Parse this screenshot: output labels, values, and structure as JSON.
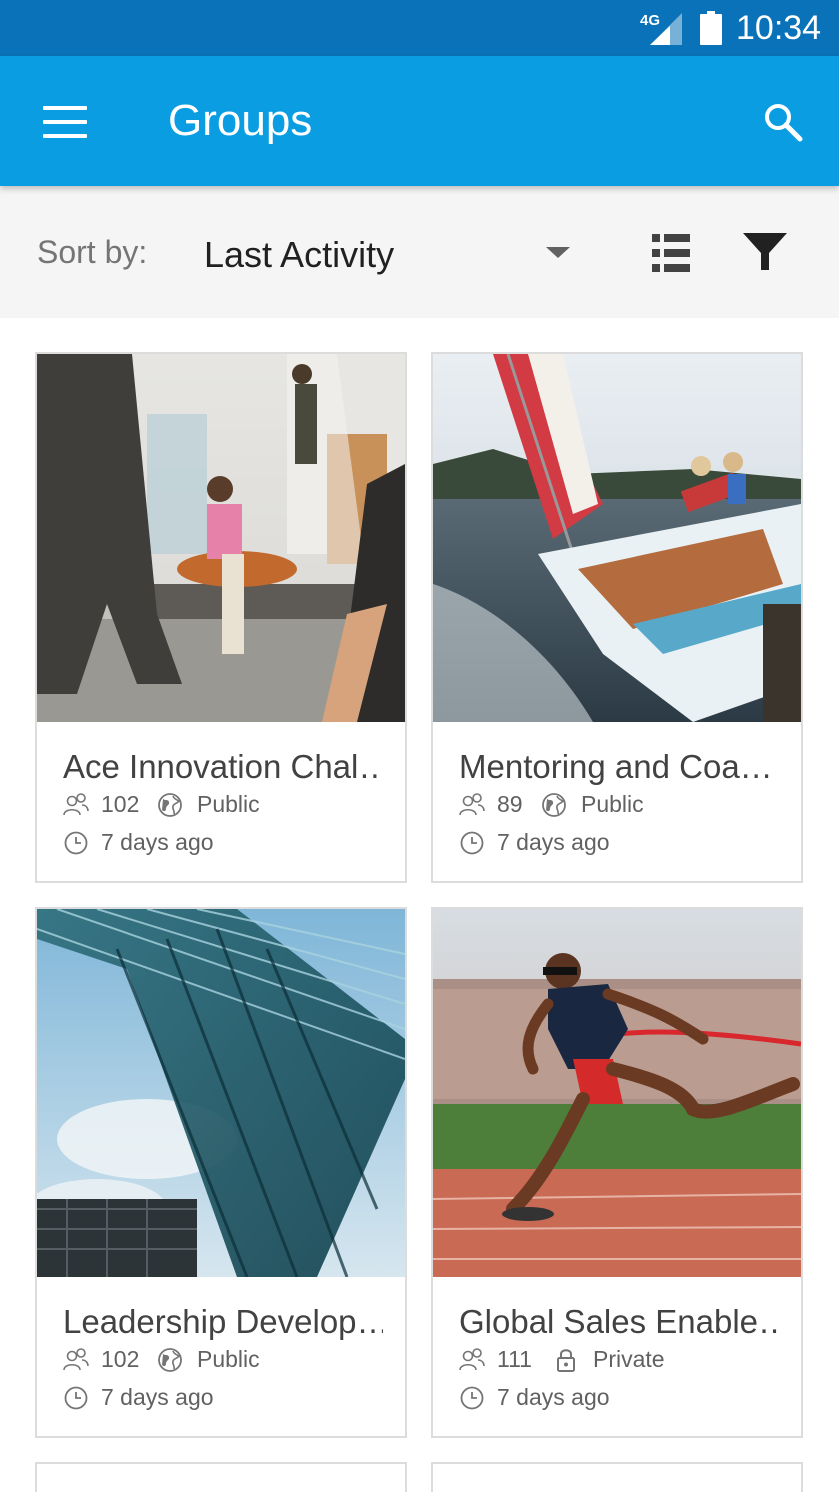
{
  "status_bar": {
    "network": "4G",
    "time": "10:34"
  },
  "app_bar": {
    "title": "Groups"
  },
  "sort": {
    "label": "Sort by:",
    "value": "Last Activity"
  },
  "groups": [
    {
      "title": "Ace Innovation Chal…",
      "members": "102",
      "visibility": "Public",
      "activity": "7 days ago"
    },
    {
      "title": "Mentoring and Coa…",
      "members": "89",
      "visibility": "Public",
      "activity": "7 days ago"
    },
    {
      "title": "Leadership Develop…",
      "members": "102",
      "visibility": "Public",
      "activity": "7 days ago"
    },
    {
      "title": "Global Sales Enable…",
      "members": "111",
      "visibility": "Private",
      "activity": "7 days ago"
    }
  ],
  "colors": {
    "status_bar": "#0a72b8",
    "app_bar": "#0b9de2",
    "sort_bar": "#f5f5f5"
  },
  "icons": [
    "menu-icon",
    "search-icon",
    "list-view-icon",
    "filter-icon",
    "members-icon",
    "globe-icon",
    "lock-icon",
    "clock-icon"
  ]
}
